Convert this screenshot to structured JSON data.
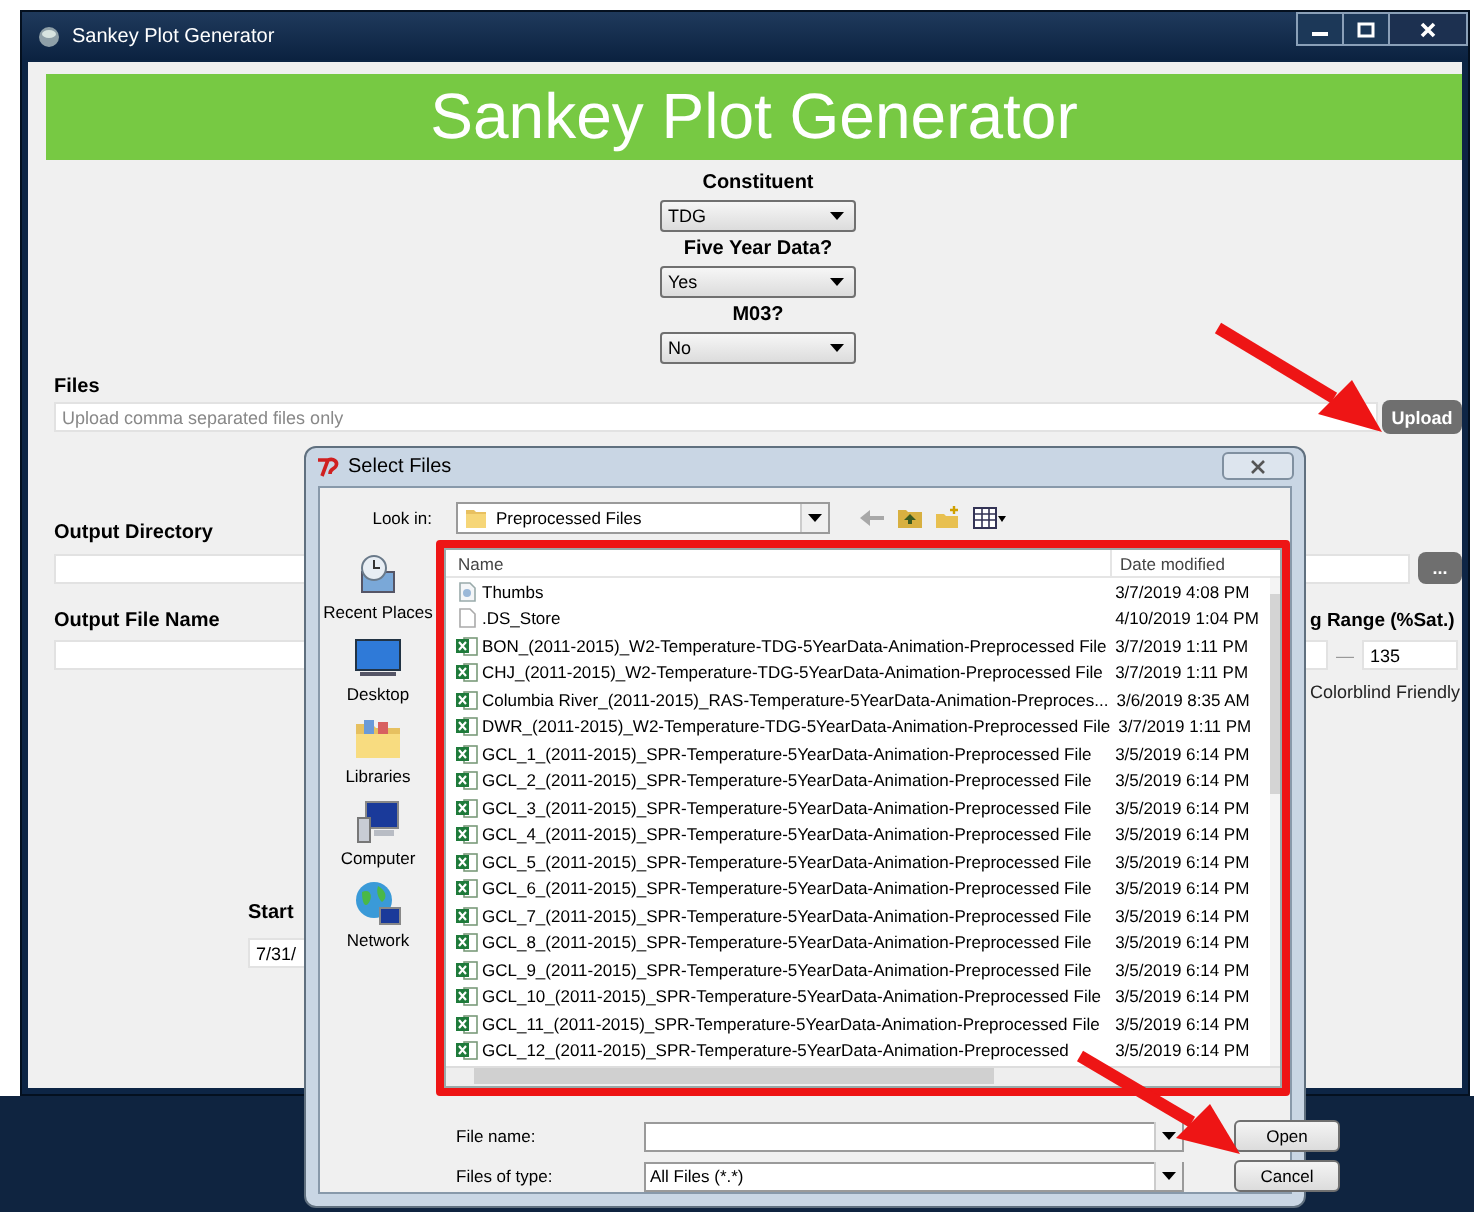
{
  "window": {
    "title": "Sankey Plot Generator"
  },
  "banner": {
    "title": "Sankey Plot Generator"
  },
  "selects": [
    {
      "label": "Constituent",
      "value": "TDG"
    },
    {
      "label": "Five Year Data?",
      "value": "Yes"
    },
    {
      "label": "M03?",
      "value": "No"
    }
  ],
  "files": {
    "label": "Files",
    "placeholder": "Upload comma separated files only",
    "button": "Upload"
  },
  "output_directory": {
    "label": "Output Directory",
    "browse_button": "..."
  },
  "output_file_name": {
    "label": "Output File Name"
  },
  "range": {
    "label": "g Range (%Sat.)",
    "separator": "—",
    "max": "135"
  },
  "colorblind": {
    "label": "Colorblind Friendly"
  },
  "start": {
    "label": "Start",
    "value": "7/31/"
  },
  "dialog": {
    "title": "Select Files",
    "look_in_label": "Look in:",
    "look_in_value": "Preprocessed Files",
    "places": [
      {
        "label": "Recent Places",
        "kind": "recent"
      },
      {
        "label": "Desktop",
        "kind": "desktop"
      },
      {
        "label": "Libraries",
        "kind": "libraries"
      },
      {
        "label": "Computer",
        "kind": "computer"
      },
      {
        "label": "Network",
        "kind": "network"
      }
    ],
    "columns": [
      "Name",
      "Date modified"
    ],
    "files": [
      {
        "name": "Thumbs",
        "date": "3/7/2019 4:08 PM",
        "kind": "image"
      },
      {
        "name": ".DS_Store",
        "date": "4/10/2019 1:04 PM",
        "kind": "blank"
      },
      {
        "name": "BON_(2011-2015)_W2-Temperature-TDG-5YearData-Animation-Preprocessed File",
        "date": "3/7/2019 1:11 PM",
        "kind": "spreadsheet"
      },
      {
        "name": "CHJ_(2011-2015)_W2-Temperature-TDG-5YearData-Animation-Preprocessed File",
        "date": "3/7/2019 1:11 PM",
        "kind": "spreadsheet"
      },
      {
        "name": "Columbia River_(2011-2015)_RAS-Temperature-5YearData-Animation-Preproces...",
        "date": "3/6/2019 8:35 AM",
        "kind": "spreadsheet"
      },
      {
        "name": "DWR_(2011-2015)_W2-Temperature-TDG-5YearData-Animation-Preprocessed File",
        "date": "3/7/2019 1:11 PM",
        "kind": "spreadsheet"
      },
      {
        "name": "GCL_1_(2011-2015)_SPR-Temperature-5YearData-Animation-Preprocessed File",
        "date": "3/5/2019 6:14 PM",
        "kind": "spreadsheet"
      },
      {
        "name": "GCL_2_(2011-2015)_SPR-Temperature-5YearData-Animation-Preprocessed File",
        "date": "3/5/2019 6:14 PM",
        "kind": "spreadsheet"
      },
      {
        "name": "GCL_3_(2011-2015)_SPR-Temperature-5YearData-Animation-Preprocessed File",
        "date": "3/5/2019 6:14 PM",
        "kind": "spreadsheet"
      },
      {
        "name": "GCL_4_(2011-2015)_SPR-Temperature-5YearData-Animation-Preprocessed File",
        "date": "3/5/2019 6:14 PM",
        "kind": "spreadsheet"
      },
      {
        "name": "GCL_5_(2011-2015)_SPR-Temperature-5YearData-Animation-Preprocessed File",
        "date": "3/5/2019 6:14 PM",
        "kind": "spreadsheet"
      },
      {
        "name": "GCL_6_(2011-2015)_SPR-Temperature-5YearData-Animation-Preprocessed File",
        "date": "3/5/2019 6:14 PM",
        "kind": "spreadsheet"
      },
      {
        "name": "GCL_7_(2011-2015)_SPR-Temperature-5YearData-Animation-Preprocessed File",
        "date": "3/5/2019 6:14 PM",
        "kind": "spreadsheet"
      },
      {
        "name": "GCL_8_(2011-2015)_SPR-Temperature-5YearData-Animation-Preprocessed File",
        "date": "3/5/2019 6:14 PM",
        "kind": "spreadsheet"
      },
      {
        "name": "GCL_9_(2011-2015)_SPR-Temperature-5YearData-Animation-Preprocessed File",
        "date": "3/5/2019 6:14 PM",
        "kind": "spreadsheet"
      },
      {
        "name": "GCL_10_(2011-2015)_SPR-Temperature-5YearData-Animation-Preprocessed File",
        "date": "3/5/2019 6:14 PM",
        "kind": "spreadsheet"
      },
      {
        "name": "GCL_11_(2011-2015)_SPR-Temperature-5YearData-Animation-Preprocessed File",
        "date": "3/5/2019 6:14 PM",
        "kind": "spreadsheet"
      },
      {
        "name": "GCL_12_(2011-2015)_SPR-Temperature-5YearData-Animation-Preprocessed",
        "date": "3/5/2019 6:14 PM",
        "kind": "spreadsheet"
      }
    ],
    "file_name_label": "File name:",
    "file_type_label": "Files of type:",
    "file_type_value": "All Files (*.*)",
    "buttons": [
      "Open",
      "Cancel"
    ]
  }
}
